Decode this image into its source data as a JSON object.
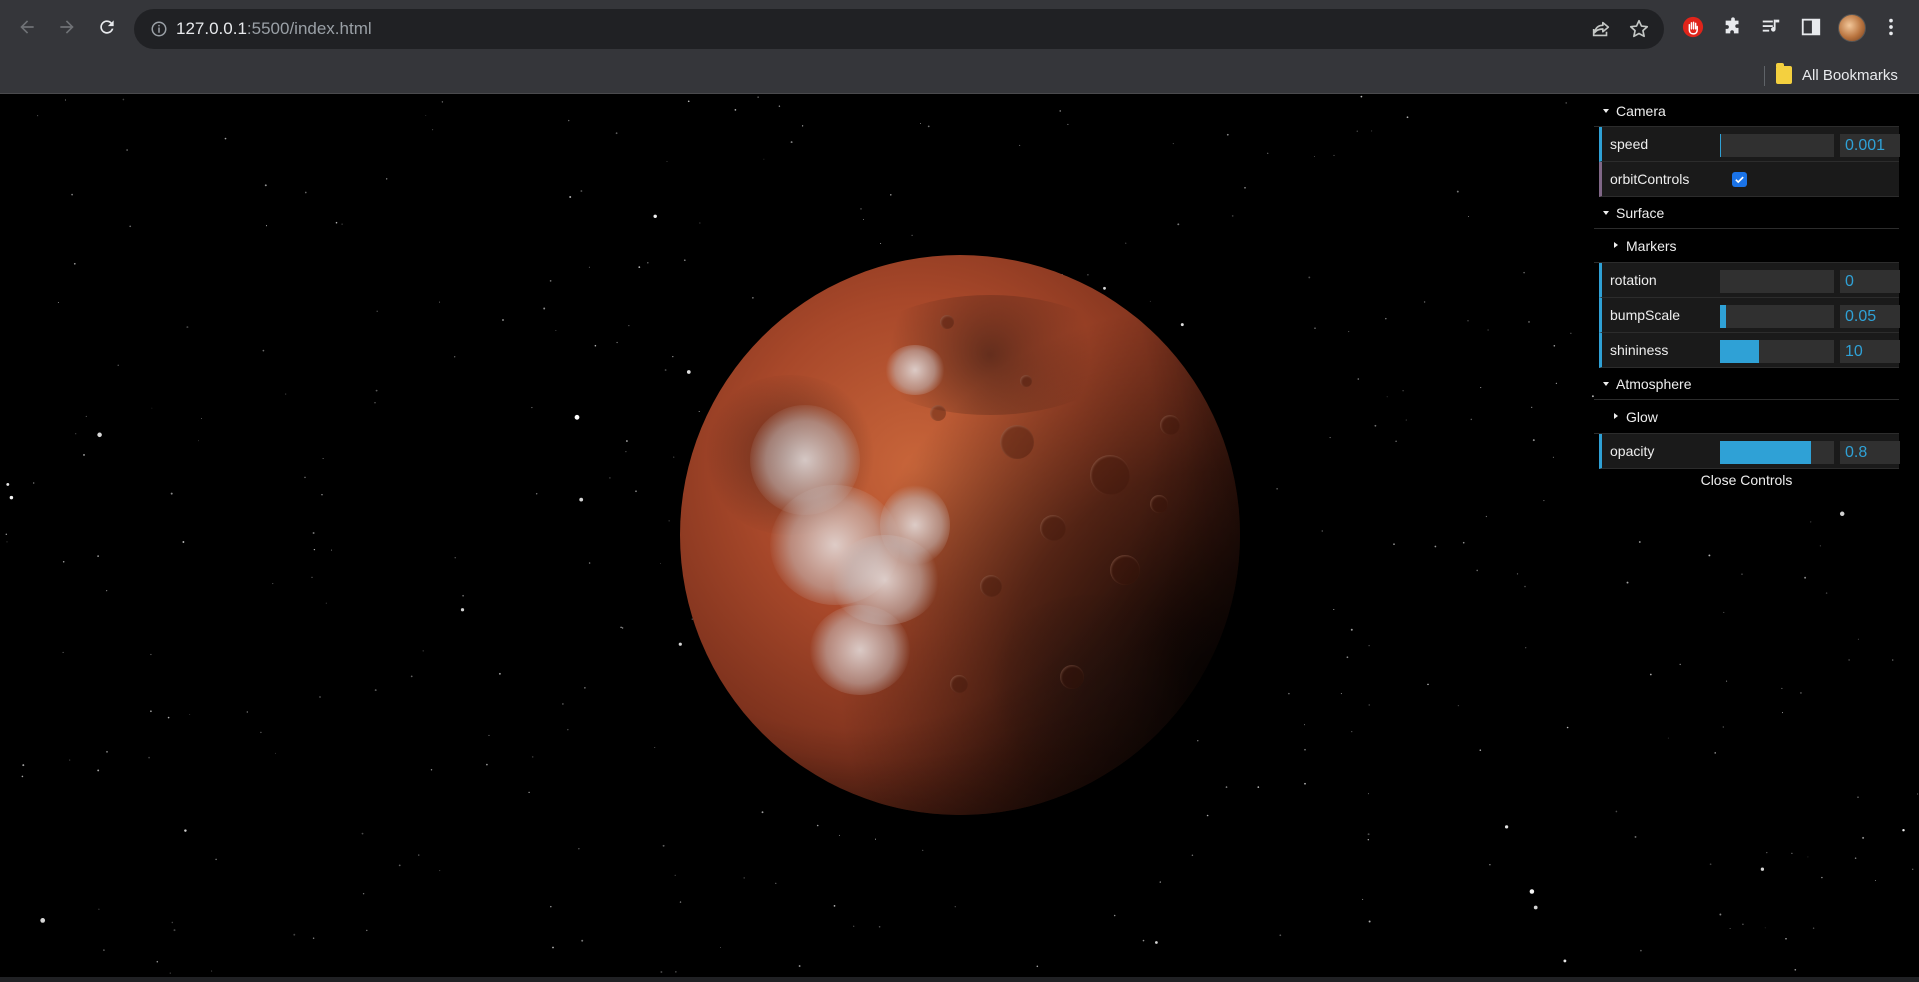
{
  "browser": {
    "url_host": "127.0.0.1",
    "url_rest": ":5500/index.html",
    "icons": {
      "back": "back-arrow-icon",
      "forward": "forward-arrow-icon",
      "reload": "reload-icon",
      "site_info": "info-icon",
      "share": "share-icon",
      "bookmark": "star-icon",
      "extension_red": "hand-extension-icon",
      "extensions": "puzzle-icon",
      "media": "media-queue-icon",
      "sidebar": "side-panel-icon",
      "menu": "kebab-menu-icon"
    },
    "bookmarks_bar": {
      "all_bookmarks_label": "All Bookmarks"
    }
  },
  "gui": {
    "accent_color": "#2fa1d6",
    "folders": [
      {
        "title": "Camera"
      },
      {
        "title": "Surface"
      },
      {
        "title": "Atmosphere"
      }
    ],
    "camera": {
      "speed": {
        "label": "speed",
        "value": "0.001",
        "fraction": 0.01
      },
      "orbitControls": {
        "label": "orbitControls",
        "checked": true
      }
    },
    "surface": {
      "markers_label": "Markers",
      "rotation": {
        "label": "rotation",
        "value": "0",
        "fraction": 0.0
      },
      "bumpScale": {
        "label": "bumpScale",
        "value": "0.05",
        "fraction": 0.05
      },
      "shininess": {
        "label": "shininess",
        "value": "10",
        "fraction": 0.34
      }
    },
    "atmosphere": {
      "glow_label": "Glow",
      "opacity": {
        "label": "opacity",
        "value": "0.8",
        "fraction": 0.8
      }
    },
    "close_label": "Close Controls"
  }
}
